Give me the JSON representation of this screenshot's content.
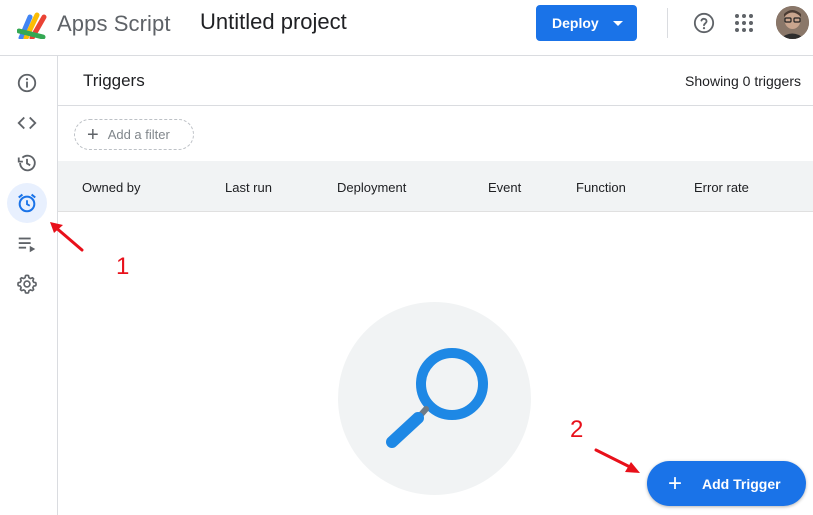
{
  "header": {
    "brand": "Apps Script",
    "project_title": "Untitled project",
    "deploy_label": "Deploy",
    "icons": [
      "apps-script-logo",
      "help-icon",
      "apps-grid-icon",
      "avatar"
    ]
  },
  "rail": {
    "items": [
      {
        "name": "overview",
        "icon": "info-icon"
      },
      {
        "name": "editor",
        "icon": "code-icon"
      },
      {
        "name": "executions",
        "icon": "history-icon"
      },
      {
        "name": "triggers",
        "icon": "alarm-clock-icon",
        "active": true
      },
      {
        "name": "executions-list",
        "icon": "playlist-play-icon"
      },
      {
        "name": "settings",
        "icon": "gear-icon"
      }
    ]
  },
  "triggers": {
    "title": "Triggers",
    "showing": "Showing 0 triggers",
    "filter_label": "Add a filter",
    "columns": [
      "Owned by",
      "Last run",
      "Deployment",
      "Event",
      "Function",
      "Error rate"
    ],
    "add_trigger_label": "Add Trigger"
  },
  "annotations": {
    "step1": "1",
    "step2": "2",
    "color": "#e8101a"
  },
  "colors": {
    "accent": "#1a73e8",
    "rail_active_bg": "#e8f0fe",
    "magnifier": "#1e88e5"
  }
}
